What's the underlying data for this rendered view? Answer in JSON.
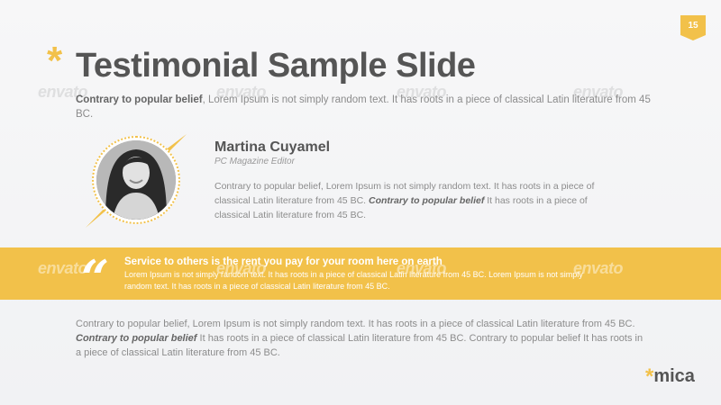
{
  "page_number": "15",
  "title": "Testimonial Sample Slide",
  "intro": {
    "bold": "Contrary to popular belief",
    "rest": ", Lorem Ipsum is not simply random text. It has roots in a piece of classical Latin literature from 45 BC."
  },
  "watermark": "envato",
  "testimonial": {
    "name": "Martina Cuyamel",
    "role": "PC Magazine Editor",
    "bio_part1": "Contrary to popular belief, Lorem Ipsum is not simply random text. It has roots in a piece of classical Latin literature from 45 BC. ",
    "bio_bold": "Contrary to popular belief",
    "bio_part2": " It has roots in a piece of classical Latin literature from 45 BC."
  },
  "quote": {
    "mark": "“",
    "title": "Service to others is the rent you pay for your room here on earth",
    "body": "Lorem Ipsum is not simply random text. It has roots in a piece of classical Latin literature from 45 BC. Lorem Ipsum is not simply random text. It has roots in a piece of classical Latin literature from 45 BC."
  },
  "footer": {
    "part1": "Contrary to popular belief, Lorem Ipsum is not simply random text. It has roots in a piece of classical Latin literature from 45 BC. ",
    "bold": "Contrary to popular belief",
    "part2": " It has roots in a piece of classical Latin literature from 45 BC. Contrary to popular belief It has roots in a piece of classical Latin literature from 45 BC."
  },
  "logo": {
    "asterisk": "*",
    "text": "mica"
  },
  "colors": {
    "accent": "#f2c14a",
    "title": "#555555",
    "body": "#8c8c8c"
  }
}
